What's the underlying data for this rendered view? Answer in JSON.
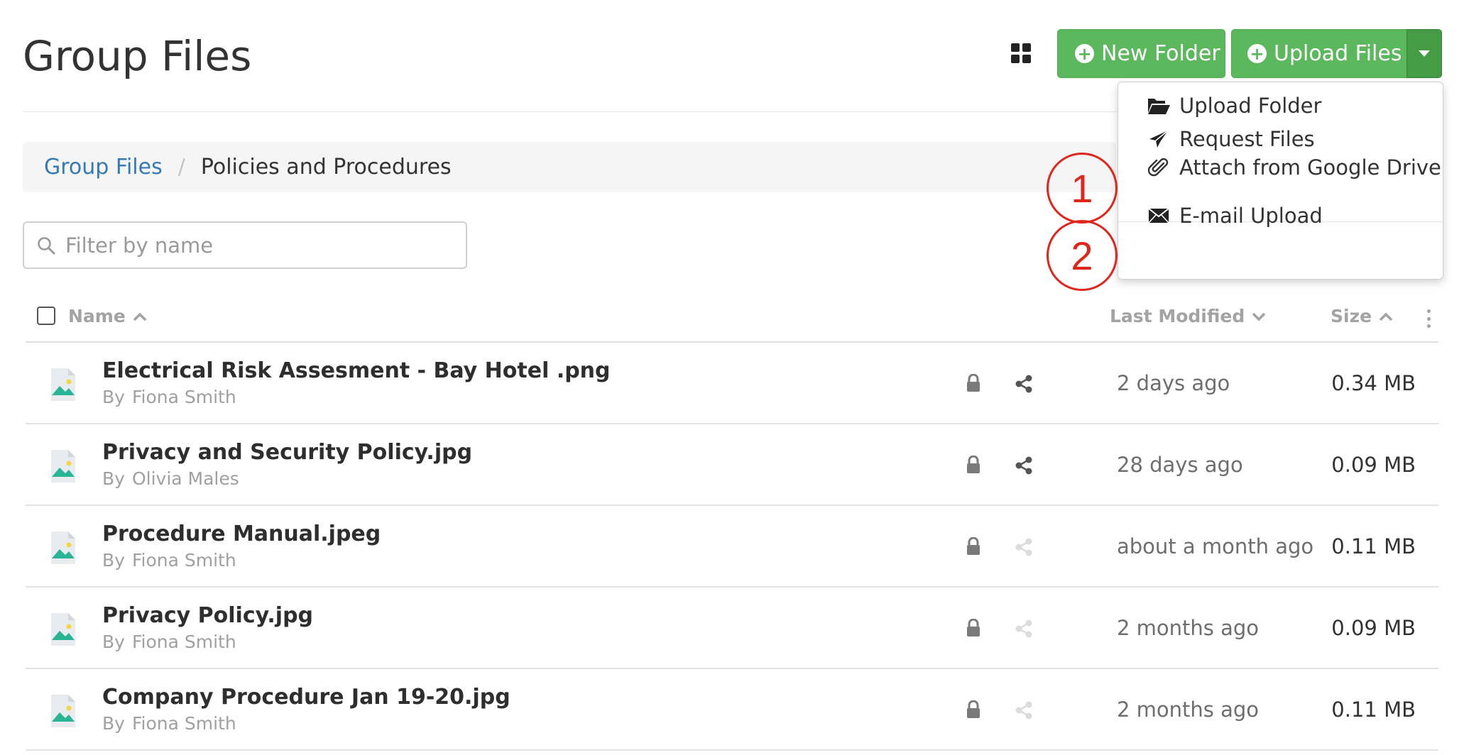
{
  "header": {
    "title": "Group Files",
    "new_folder_label": "New Folder",
    "upload_files_label": "Upload Files"
  },
  "breadcrumb": {
    "root": "Group Files",
    "separator": "/",
    "current": "Policies and Procedures"
  },
  "filter": {
    "placeholder": "Filter by name",
    "value": ""
  },
  "table": {
    "columns": {
      "name": "Name",
      "last_modified": "Last Modified",
      "size": "Size"
    },
    "by_prefix": "By",
    "rows": [
      {
        "name": "Electrical Risk Assesment - Bay Hotel .png",
        "author": "Fiona Smith",
        "modified": "2 days ago",
        "size": "0.34 MB",
        "shared": true
      },
      {
        "name": "Privacy and Security Policy.jpg",
        "author": "Olivia Males",
        "modified": "28 days ago",
        "size": "0.09 MB",
        "shared": true
      },
      {
        "name": "Procedure Manual.jpeg",
        "author": "Fiona Smith",
        "modified": "about a month ago",
        "size": "0.11 MB",
        "shared": false
      },
      {
        "name": "Privacy Policy.jpg",
        "author": "Fiona Smith",
        "modified": "2 months ago",
        "size": "0.09 MB",
        "shared": false
      },
      {
        "name": "Company Procedure Jan 19-20.jpg",
        "author": "Fiona Smith",
        "modified": "2 months ago",
        "size": "0.11 MB",
        "shared": false
      }
    ]
  },
  "upload_menu": {
    "items": [
      {
        "label": "Upload Folder",
        "icon": "folder-open-icon"
      },
      {
        "label": "Request Files",
        "icon": "paper-plane-icon"
      },
      {
        "label": "Attach from Google Drive",
        "icon": "paperclip-icon"
      },
      {
        "label": "E-mail Upload",
        "icon": "envelope-icon"
      }
    ]
  },
  "annotations": [
    "1",
    "2"
  ],
  "colors": {
    "primary_green": "#5cb85c",
    "dark_green": "#449d44",
    "link_blue": "#337ab7",
    "callout_red": "#e0261b"
  }
}
